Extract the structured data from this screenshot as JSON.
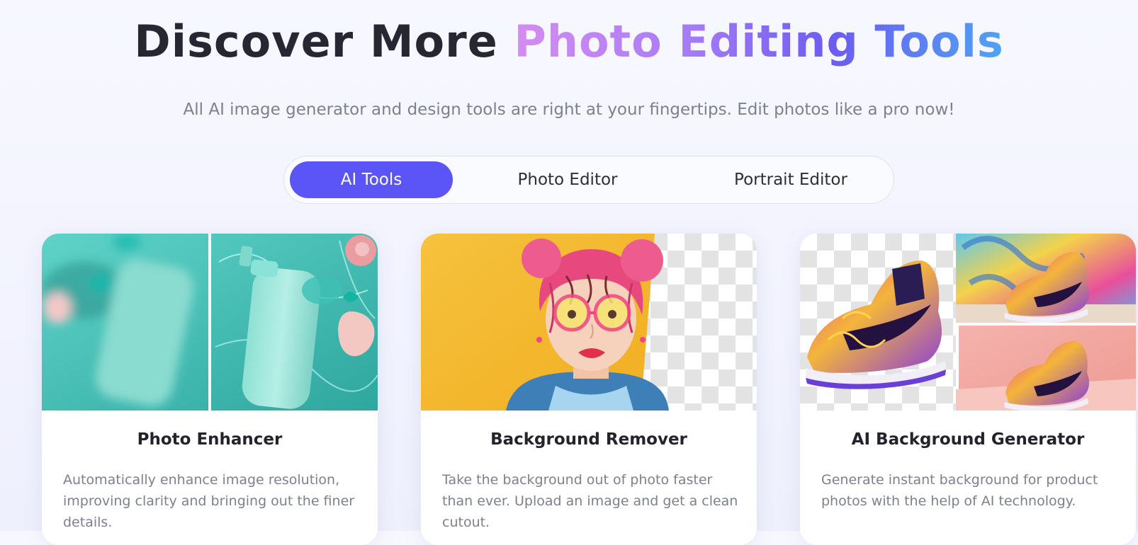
{
  "header": {
    "title_plain": "Discover More ",
    "title_highlight": "Photo Editing Tools",
    "subtitle": "All AI image generator and design tools are right at your fingertips. Edit photos like a pro now!"
  },
  "tabs": [
    {
      "label": "AI Tools",
      "active": true
    },
    {
      "label": "Photo Editor",
      "active": false
    },
    {
      "label": "Portrait Editor",
      "active": false
    }
  ],
  "cards": [
    {
      "title": "Photo Enhancer",
      "description": "Automatically enhance image resolution, improving clarity and bringing out the finer details.",
      "image": "before-after-bottle-in-water"
    },
    {
      "title": "Background Remover",
      "description": "Take the background out of photo faster than ever. Upload an image and get a clean cutout.",
      "image": "girl-with-glasses-cutout"
    },
    {
      "title": "AI Background Generator",
      "description": "Generate instant background for product photos with the help of AI technology.",
      "image": "sneaker-with-generated-backgrounds"
    }
  ],
  "colors": {
    "accent": "#5b55f7",
    "title_gradient": [
      "#d58cf1",
      "#a77cf6",
      "#6c5cf1",
      "#4fa3f4"
    ],
    "heading_text": "#262733",
    "muted_text": "#7d808f"
  }
}
